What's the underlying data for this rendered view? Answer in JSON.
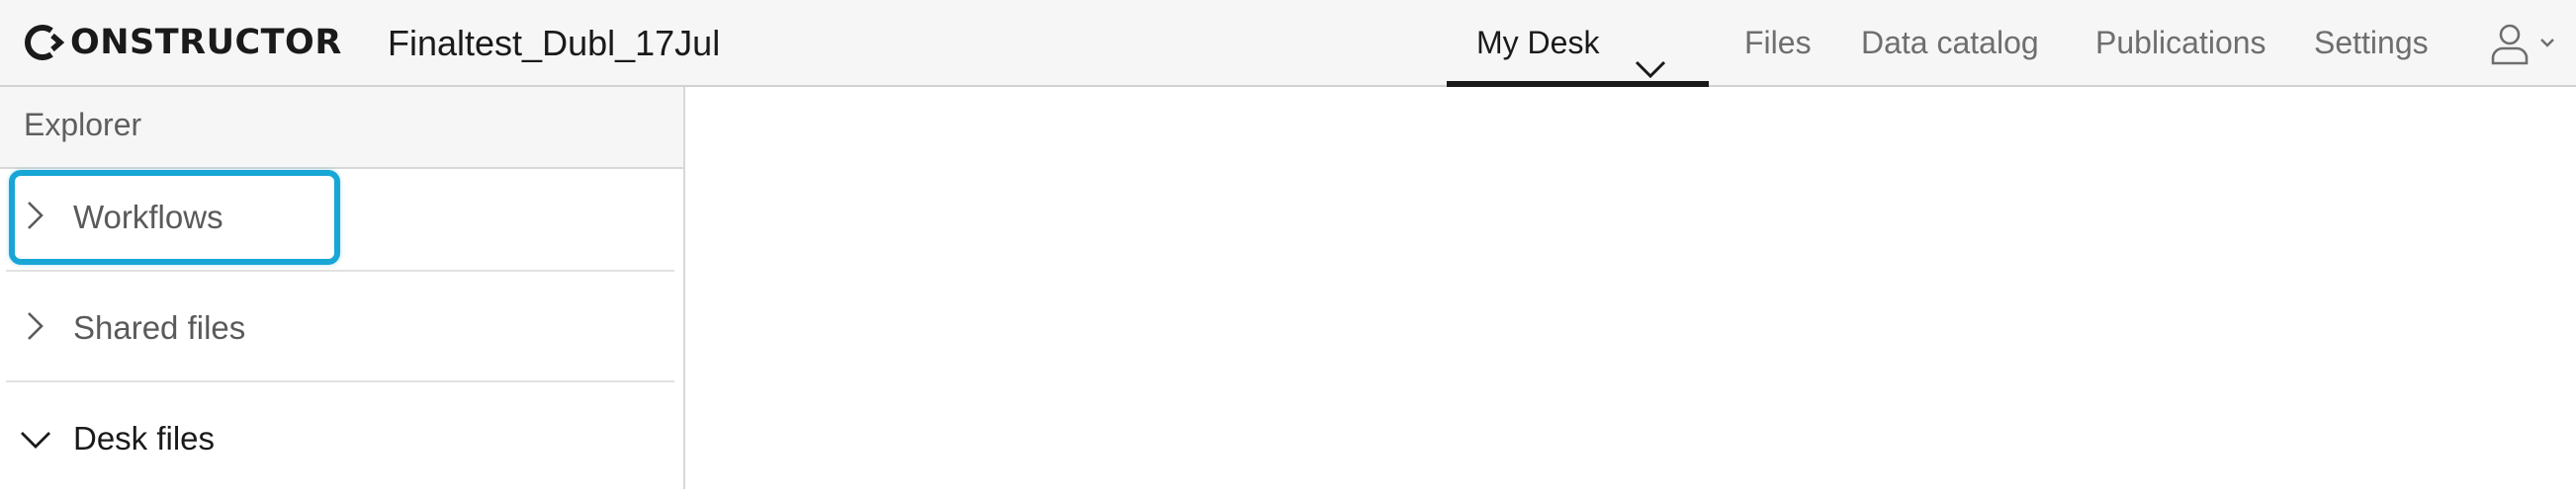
{
  "app": {
    "logo_text": "ONSTRUCTOR",
    "logo_mark_icon": "logo-c-chevron-icon",
    "project_title": "Finaltest_Dubl_17Jul"
  },
  "nav": {
    "items": [
      {
        "label": "My Desk",
        "active": true,
        "icon": "chevron-down-icon"
      },
      {
        "label": "Files",
        "active": false
      },
      {
        "label": "Data catalog",
        "active": false
      },
      {
        "label": "Publications",
        "active": false
      },
      {
        "label": "Settings",
        "active": false
      }
    ],
    "user_icon": "user-icon",
    "user_chevron_icon": "chevron-down-icon"
  },
  "sidebar": {
    "title": "Explorer",
    "items": [
      {
        "label": "Workflows",
        "expanded": false,
        "icon": "chevron-right-icon",
        "highlighted": true
      },
      {
        "label": "Shared files",
        "expanded": false,
        "icon": "chevron-right-icon"
      },
      {
        "label": "Desk files",
        "expanded": true,
        "icon": "chevron-down-icon"
      }
    ]
  },
  "colors": {
    "highlight": "#18a6d6",
    "active_underline": "#1a1a1a",
    "topbar_bg": "#f6f6f6",
    "inactive_text": "#6e6e6e"
  }
}
